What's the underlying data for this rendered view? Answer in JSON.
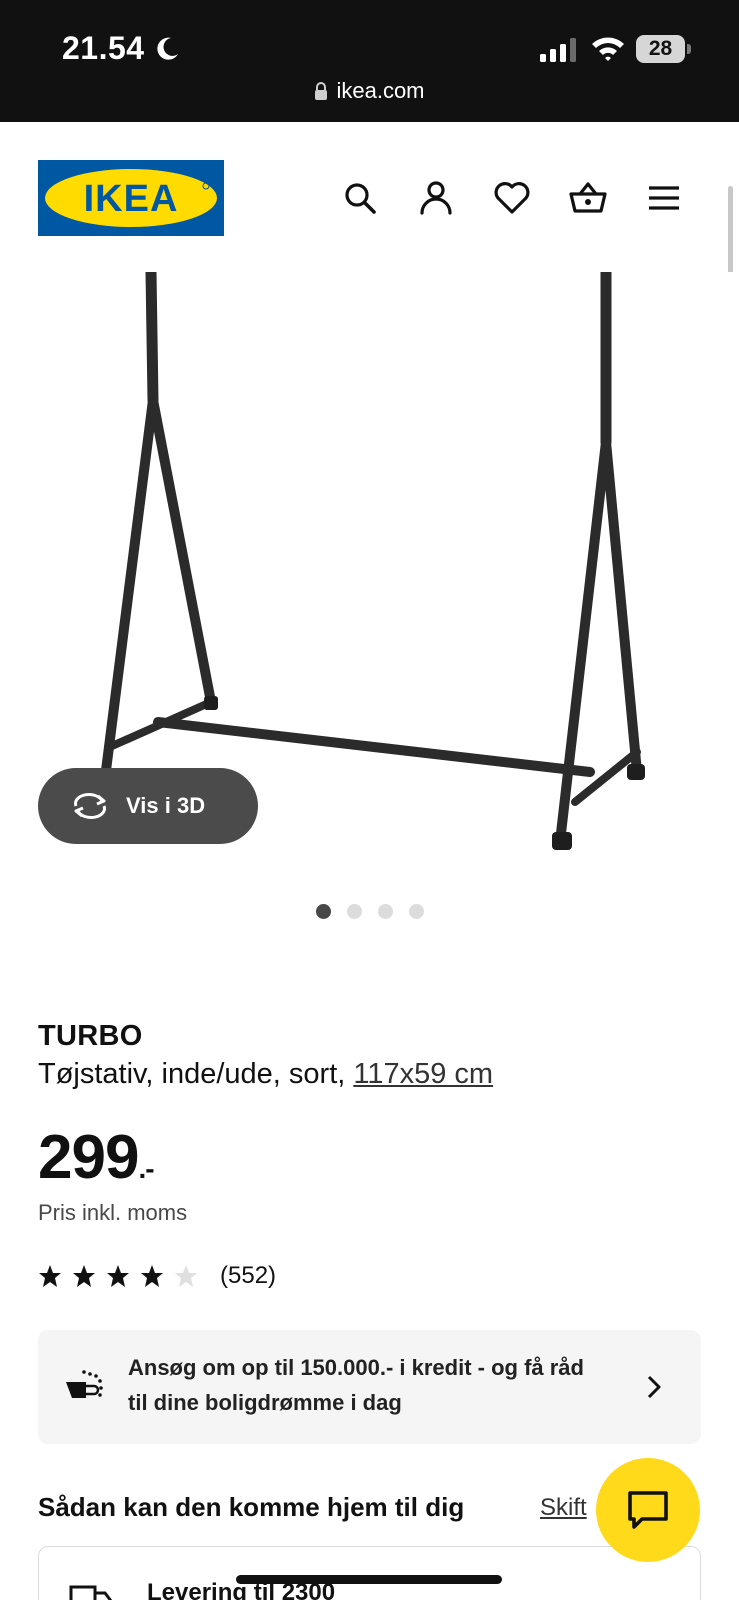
{
  "status_bar": {
    "time": "21.54",
    "battery": "28",
    "url": "ikea.com"
  },
  "header": {
    "logo_text": "IKEA",
    "brand_colors": {
      "blue": "#0058a3",
      "yellow": "#ffdb00"
    },
    "icons": [
      "search-icon",
      "account-icon",
      "heart-icon",
      "basket-icon",
      "menu-icon"
    ]
  },
  "gallery": {
    "view_3d_label": "Vis i 3D",
    "image_count": 4,
    "active_index": 0
  },
  "product": {
    "name": "TURBO",
    "description": "Tøjstativ, inde/ude, sort, ",
    "size_link": "117x59 cm",
    "price": "299",
    "price_suffix": ".-",
    "price_note": "Pris inkl. moms",
    "rating": 4,
    "rating_max": 5,
    "review_count": "(552)"
  },
  "credit_banner": {
    "text": "Ansøg om op til 150.000.- i kredit - og få råd til dine boligdrømme i dag"
  },
  "delivery": {
    "heading": "Sådan kan den komme hjem til dig",
    "change_link": "Skift",
    "option_label": "Levering til 2300"
  },
  "colors": {
    "chat_fab": "#ffda1a",
    "status_bar_bg": "#111111"
  }
}
